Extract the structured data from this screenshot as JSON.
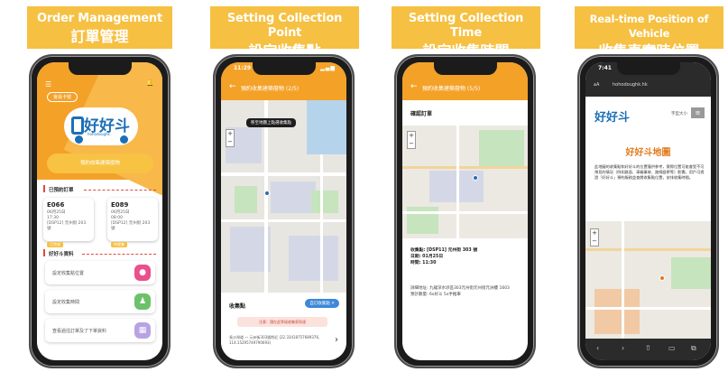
{
  "captions": [
    {
      "en": "Order Management",
      "zh": "訂單管理"
    },
    {
      "en": "Setting Collection Point",
      "zh": "設定收集點"
    },
    {
      "en": "Setting Collection Time",
      "zh": "設定收集時間"
    },
    {
      "en": "Real-time Position of Vehicle",
      "zh": "收集車實時位置"
    }
  ],
  "accent_color": "#f4a128",
  "phone1": {
    "pill": "會員卡號",
    "logo_text": "好好斗",
    "logo_sub": "hohodoughk",
    "book_button": "預約收集建築廢物",
    "orders_title": "已預約訂單",
    "orders": [
      {
        "code": "E066",
        "line1": "06月25日",
        "line2": "17:30",
        "line3": "[DSP12] 元州街 203 號",
        "tag": "已完成"
      },
      {
        "code": "E089",
        "line1": "06月25日",
        "line2": "08:00",
        "line3": "[DSP12] 元州街 203 號",
        "tag": "待收集"
      }
    ],
    "info_title": "好好斗資料",
    "actions": [
      {
        "label": "設定收集點位置",
        "icon": "location-pin-icon",
        "icon_char": "⬤",
        "color": "#ea4f8e"
      },
      {
        "label": "設定收集時間",
        "icon": "person-icon",
        "icon_char": "♟",
        "color": "#6cc16a"
      },
      {
        "label": "查看過往訂單及了下單資料",
        "icon": "calendar-icon",
        "icon_char": "▦",
        "color": "#b9a2e3"
      }
    ]
  },
  "phone2": {
    "time": "11:29",
    "title": "預約收集建築廢物 (2/5)",
    "map_banner": "移至地圖上點選收集點",
    "panel_title": "收集點",
    "reset_button": "自訂收集點 ✕",
    "warning": "注意：請在此等候收集車到達",
    "address": "長沙灣道 — 元州街303號附近 (22.33418757689376, 114.15295749790693)"
  },
  "phone3": {
    "title": "預約收集建築廢物 (5/5)",
    "confirm": "確認訂單",
    "info": [
      "收集點: [DSP11] 元州街 303 號",
      "日期: 01月25日",
      "時間: 11:30"
    ],
    "detail": [
      "詳細地址: 九龍深水埗區303元州街元州街元洲樓 1603",
      "預計數量: 6x好斗  5x手推車"
    ]
  },
  "phone4": {
    "time": "7:41",
    "url": "hohodoughk.hk",
    "logo": "好好斗",
    "small_link": "字型大小",
    "heading": "好好斗地圖",
    "body": "此地圖的收集點和好好斗的位置僅供參考，實際位置可能會受不可預見的情況（例如路面、車輛事故、路線變更等）影響。用戶可透過「好好斗」預約服務並查閱收集點位置，安排收集時間。"
  }
}
